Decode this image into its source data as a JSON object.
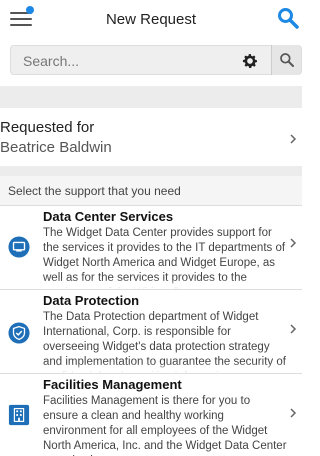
{
  "header": {
    "title": "New Request",
    "menu_icon": "hamburger-menu-icon",
    "search_icon": "search-icon",
    "accent_color": "#1e88e5"
  },
  "search": {
    "placeholder": "Search...",
    "settings_icon": "gear-icon",
    "submit_icon": "search-icon"
  },
  "requested_for": {
    "label": "Requested for",
    "value": "Beatrice Baldwin"
  },
  "support": {
    "prompt": "Select the support that you need",
    "items": [
      {
        "name": "Data Center Services",
        "description": "The Widget Data Center provides support for the services it provides to the IT departments of Widget North America and Widget Europe, as well as for the services it provides to the employees of the Widget Data",
        "icon": "computer-screen-icon"
      },
      {
        "name": "Data Protection",
        "description": "The Data Protection department of Widget International, Corp. is responsible for overseeing Widget's data protection strategy and implementation to guarantee the security of confidential and sensitive information.",
        "icon": "shield-check-icon"
      },
      {
        "name": "Facilities Management",
        "description": "Facilities Management is there for you to ensure a clean and healthy working environment for all employees of the Widget North America, Inc. and the Widget Data Center organizations.",
        "icon": "building-icon"
      }
    ]
  }
}
